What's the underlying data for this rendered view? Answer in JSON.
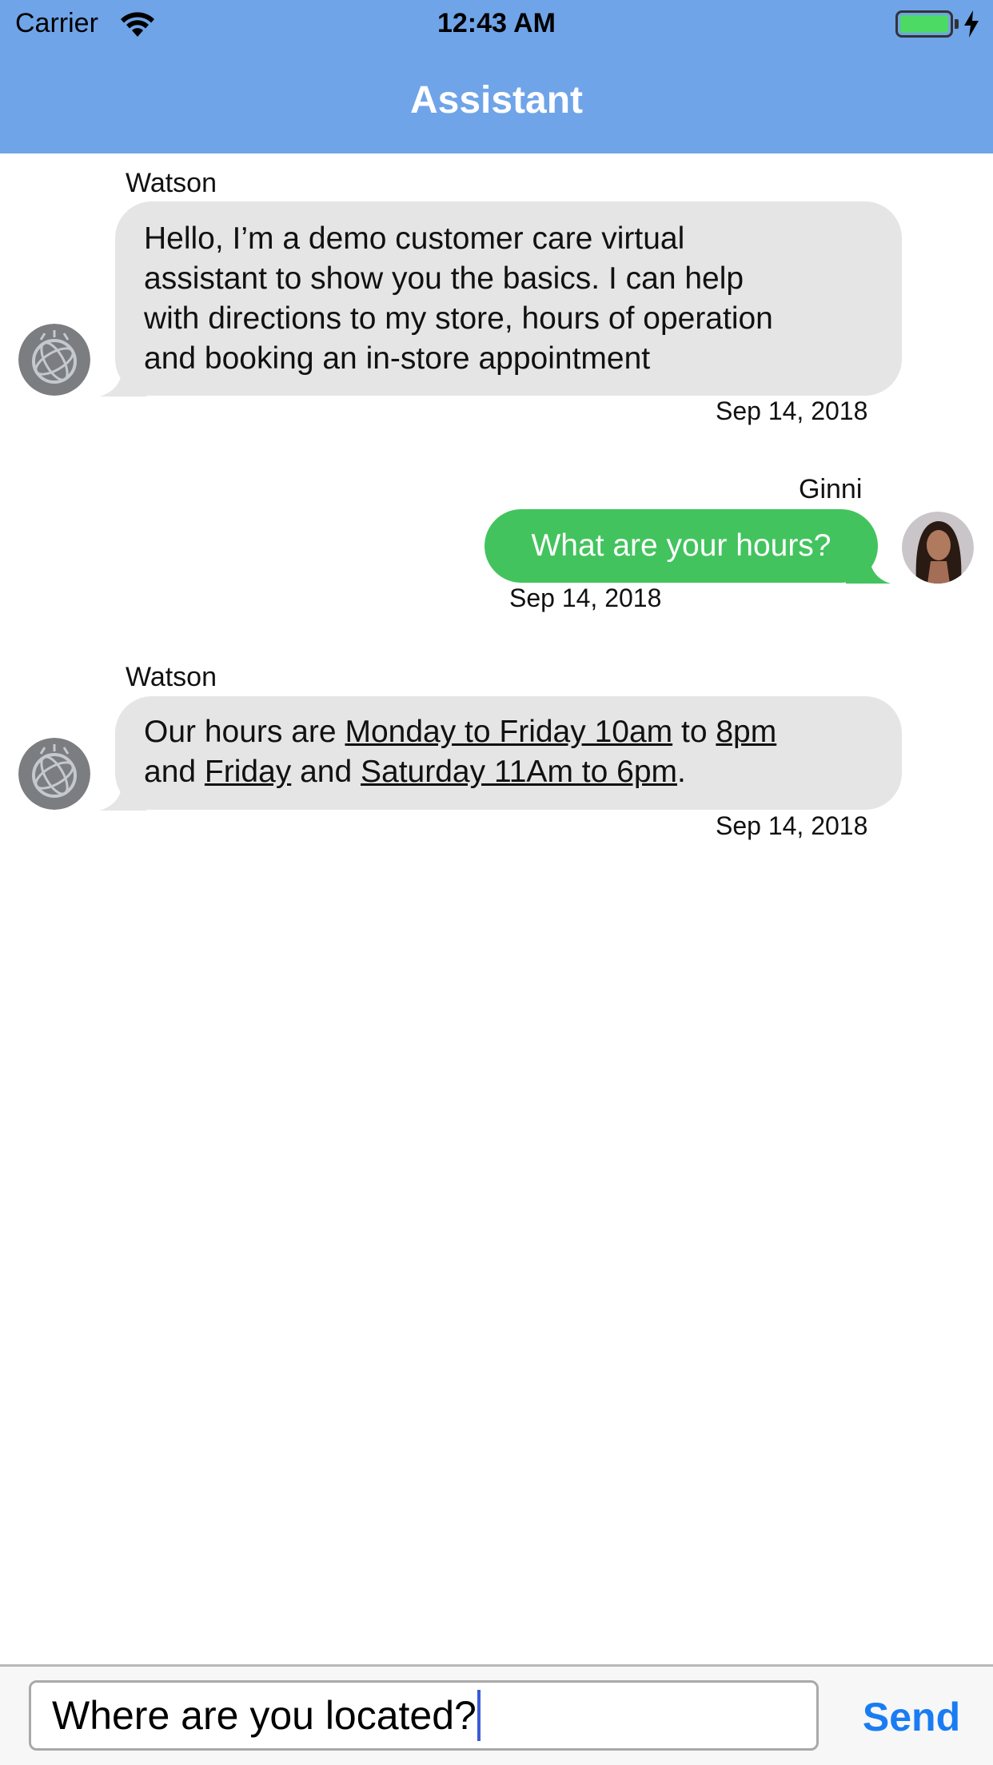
{
  "status_bar": {
    "carrier": "Carrier",
    "time": "12:43 AM",
    "wifi_icon": "wifi-icon",
    "battery_icon": "battery-charging-icon"
  },
  "nav": {
    "title": "Assistant"
  },
  "colors": {
    "nav_background": "#6fa4e8",
    "incoming_bubble": "#e5e5e5",
    "outgoing_bubble": "#43c35e",
    "send_button": "#1a7cf2"
  },
  "messages": [
    {
      "sender": "Watson",
      "direction": "incoming",
      "lines": [
        "Hello, I’m a demo customer care virtual",
        "assistant to show you the basics.  I can help",
        "with directions to my store, hours of operation",
        "and booking an in-store appointment"
      ],
      "timestamp": "Sep 14, 2018",
      "avatar": "watson-globe-icon"
    },
    {
      "sender": "Ginni",
      "direction": "outgoing",
      "text": "What are your hours?",
      "timestamp": "Sep 14, 2018",
      "avatar": "user-photo"
    },
    {
      "sender": "Watson",
      "direction": "incoming",
      "parts": [
        "Our hours are ",
        "Monday to Friday 10am",
        " to ",
        "8pm",
        "and ",
        "Friday",
        " and ",
        "Saturday 11Am to 6pm",
        "."
      ],
      "timestamp": "Sep 14, 2018",
      "avatar": "watson-globe-icon"
    }
  ],
  "composer": {
    "value": "Where are you located?",
    "send_label": "Send"
  }
}
